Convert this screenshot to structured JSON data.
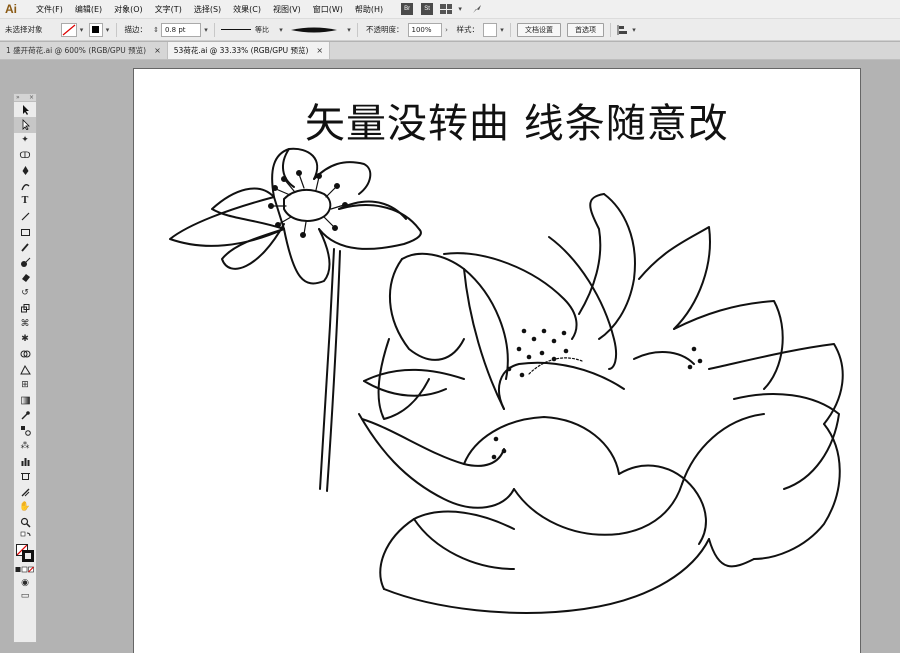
{
  "app": {
    "logo": "Ai"
  },
  "menu": {
    "items": [
      "文件(F)",
      "编辑(E)",
      "对象(O)",
      "文字(T)",
      "选择(S)",
      "效果(C)",
      "视图(V)",
      "窗口(W)",
      "帮助(H)"
    ],
    "badges": [
      "Br",
      "St"
    ]
  },
  "control": {
    "selection": "未选择对象",
    "stroke_label": "描边：",
    "stroke_value": "0.8 pt",
    "profile": "等比",
    "opacity_label": "不透明度：",
    "opacity_value": "100%",
    "style_label": "样式：",
    "doc_setup": "文档设置",
    "preferences": "首选项"
  },
  "tabs": [
    {
      "label": "1 盛开荷花.ai @ 600% (RGB/GPU 预览)",
      "close": "×"
    },
    {
      "label": "53荷花.ai @ 33.33% (RGB/GPU 预览)",
      "close": "×"
    }
  ],
  "artboard": {
    "headline": "矢量没转曲 线条随意改"
  },
  "toolbox": {
    "tools": [
      "selection-tool",
      "direct-selection-tool",
      "magic-wand-tool",
      "lasso-tool",
      "pen-tool",
      "curvature-tool",
      "type-tool",
      "line-tool",
      "rectangle-tool",
      "paintbrush-tool",
      "shaper-tool",
      "eraser-tool",
      "rotate-tool",
      "scale-tool",
      "width-tool",
      "puppet-warp-tool",
      "shape-builder-tool",
      "perspective-grid-tool",
      "mesh-tool",
      "gradient-tool",
      "eyedropper-tool",
      "blend-tool",
      "symbol-sprayer-tool",
      "column-graph-tool",
      "artboard-tool",
      "slice-tool",
      "hand-tool",
      "zoom-tool"
    ]
  },
  "colors": {
    "accent": "#8a5a14",
    "canvas_bg": "#b3b3b3"
  }
}
